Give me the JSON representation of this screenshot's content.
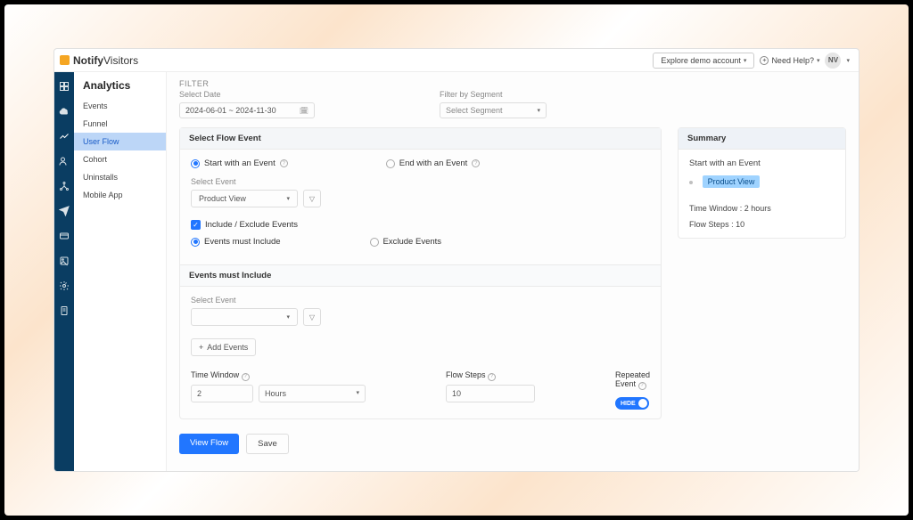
{
  "brand": {
    "bold": "Notify",
    "light": "Visitors"
  },
  "topbar": {
    "explore": "Explore demo account",
    "help": "Need Help?",
    "avatar": "NV"
  },
  "page_title": "Analytics",
  "sidebar": {
    "items": [
      {
        "label": "Events"
      },
      {
        "label": "Funnel"
      },
      {
        "label": "User Flow",
        "active": true
      },
      {
        "label": "Cohort"
      },
      {
        "label": "Uninstalls"
      },
      {
        "label": "Mobile App"
      }
    ]
  },
  "filter": {
    "title": "FILTER",
    "date_label": "Select Date",
    "date_value": "2024-06-01 ~ 2024-11-30",
    "segment_label": "Filter by Segment",
    "segment_value": "Select Segment"
  },
  "flow": {
    "header": "Select Flow Event",
    "start_label": "Start with an Event",
    "end_label": "End with an Event",
    "select_event_label": "Select Event",
    "selected_event": "Product View",
    "include_exclude_label": "Include / Exclude Events",
    "must_include_label": "Events must Include",
    "exclude_label": "Exclude Events",
    "must_include_header": "Events must Include",
    "add_events": "Add Events",
    "time_window_label": "Time Window",
    "time_value": "2",
    "time_unit": "Hours",
    "flow_steps_label": "Flow Steps",
    "flow_steps_value": "10",
    "repeated_label": "Repeated Event",
    "toggle_label": "HIDE"
  },
  "summary": {
    "header": "Summary",
    "start_label": "Start with an Event",
    "event": "Product View",
    "time_window": "Time Window : 2 hours",
    "flow_steps": "Flow Steps : 10"
  },
  "actions": {
    "view": "View Flow",
    "save": "Save"
  }
}
